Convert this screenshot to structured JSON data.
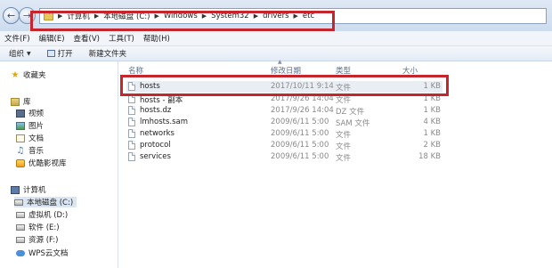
{
  "address": {
    "crumbs": [
      "计算机",
      "本地磁盘 (C:)",
      "Windows",
      "System32",
      "drivers",
      "etc"
    ]
  },
  "menu": [
    "文件(F)",
    "编辑(E)",
    "查看(V)",
    "工具(T)",
    "帮助(H)"
  ],
  "toolbar": {
    "organize": "组织",
    "open": "打开",
    "new_folder": "新建文件夹"
  },
  "nav": {
    "favorites": "收藏夹",
    "libraries": "库",
    "videos": "视频",
    "pictures": "图片",
    "documents": "文档",
    "music": "音乐",
    "youku": "优酷影视库",
    "computer": "计算机",
    "drive_c": "本地磁盘 (C:)",
    "drive_d": "虚拟机 (D:)",
    "drive_e": "软件 (E:)",
    "drive_f": "资源 (F:)",
    "wps": "WPS云文档"
  },
  "columns": {
    "name": "名称",
    "modified": "修改日期",
    "type": "类型",
    "size": "大小"
  },
  "files": [
    {
      "name": "hosts",
      "modified": "2017/10/11 9:14",
      "type": "文件",
      "size": "1 KB"
    },
    {
      "name": "hosts - 副本",
      "modified": "2017/9/26 14:04",
      "type": "文件",
      "size": "1 KB"
    },
    {
      "name": "hosts.dz",
      "modified": "2017/9/26 14:04",
      "type": "DZ 文件",
      "size": "1 KB"
    },
    {
      "name": "lmhosts.sam",
      "modified": "2009/6/11 5:00",
      "type": "SAM 文件",
      "size": "4 KB"
    },
    {
      "name": "networks",
      "modified": "2009/6/11 5:00",
      "type": "文件",
      "size": "1 KB"
    },
    {
      "name": "protocol",
      "modified": "2009/6/11 5:00",
      "type": "文件",
      "size": "2 KB"
    },
    {
      "name": "services",
      "modified": "2009/6/11 5:00",
      "type": "文件",
      "size": "18 KB"
    }
  ],
  "colors": {
    "highlight_box": "#c5252b",
    "selection": "#dbe6f4"
  }
}
